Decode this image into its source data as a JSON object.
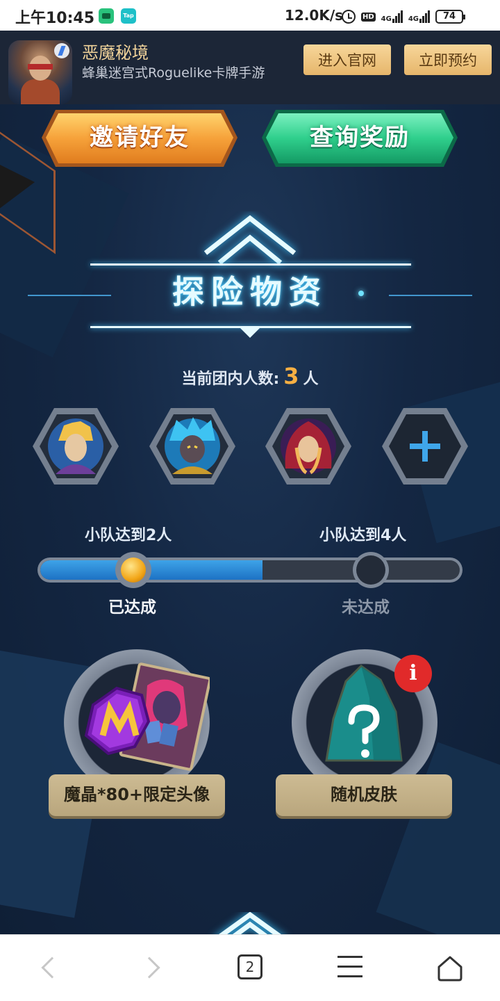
{
  "status_bar": {
    "time": "上午10:45",
    "app2": "Tap",
    "net_speed": "12.0K/s",
    "hd": "HD",
    "sig1": "4G",
    "sig2": "4G",
    "battery": "74"
  },
  "banner": {
    "title": "恶魔秘境",
    "subtitle": "蜂巢迷宫式Roguelike卡牌手游",
    "official_label": "进入官网",
    "reserve_label": "立即预约"
  },
  "actions": {
    "invite_label": "邀请好友",
    "query_label": "查询奖励"
  },
  "section": {
    "title": "探险物资",
    "member_prefix": "当前团内人数:",
    "member_count": "3",
    "member_suffix": "人"
  },
  "milestones": [
    {
      "label": "小队达到2人",
      "status": "已达成",
      "status_color": "#f3f5f9"
    },
    {
      "label": "小队达到4人",
      "status": "未达成",
      "status_color": "#8d98a8"
    }
  ],
  "progress": {
    "fraction": 0.53
  },
  "rewards": [
    {
      "label": "魔晶*80+限定头像",
      "icon": "crystal-portrait-icon"
    },
    {
      "label": "随机皮肤",
      "icon": "mystery-skin-icon",
      "badge": "i"
    }
  ],
  "bottom_nav": {
    "tab_count": "2"
  },
  "colors": {
    "accent_gold": "#f7b043",
    "banner_gold": "#f1d39a",
    "invite_orange": "#f2a33d",
    "query_green": "#2fcf8c",
    "glow_cyan": "#3cc6ff"
  }
}
